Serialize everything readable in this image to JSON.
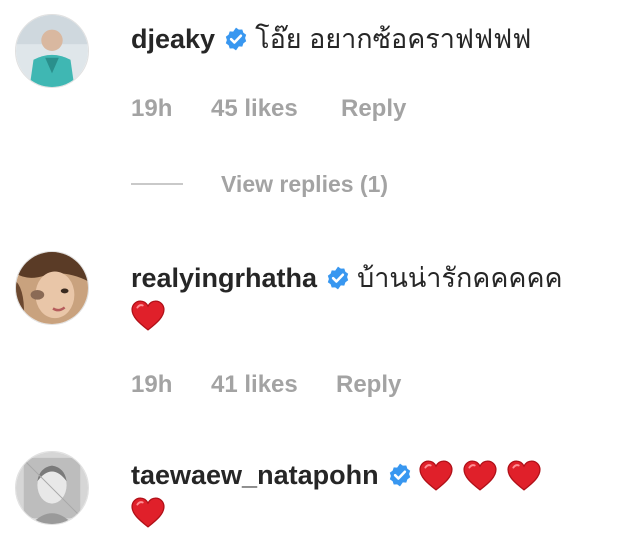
{
  "comments": [
    {
      "username": "djeaky",
      "text": "โอ๊ย อยากซ้อคราฟฟฟฟ",
      "time": "19h",
      "likes": "45 likes",
      "reply": "Reply",
      "view_replies": "View replies (1)"
    },
    {
      "username": "realyingrhatha",
      "text": "บ้านน่ารักคคคคค",
      "time": "19h",
      "likes": "41 likes",
      "reply": "Reply"
    },
    {
      "username": "taewaew_natapohn"
    }
  ],
  "icons": {
    "verified": "verified-badge-icon",
    "heart": "red-heart-emoji"
  },
  "colors": {
    "verified_blue": "#3897f0",
    "heart_red": "#e0202a",
    "meta_gray": "#a3a3a3",
    "text": "#262626"
  }
}
